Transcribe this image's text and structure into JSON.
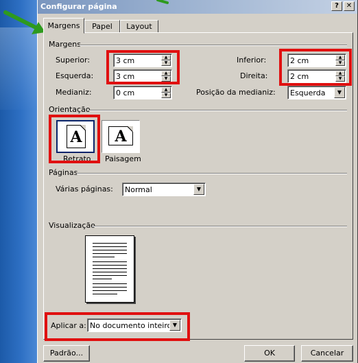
{
  "dialog": {
    "title": "Configurar página",
    "help_label": "?",
    "close_label": "✕"
  },
  "tabs": [
    {
      "label": "Margens"
    },
    {
      "label": "Papel"
    },
    {
      "label": "Layout"
    }
  ],
  "margins": {
    "group_title": "Margens",
    "top": {
      "label": "Superior:",
      "value": "3 cm"
    },
    "left": {
      "label": "Esquerda:",
      "value": "3 cm"
    },
    "gutter": {
      "label": "Medianiz:",
      "value": "0 cm"
    },
    "bottom": {
      "label": "Inferior:",
      "value": "2 cm"
    },
    "right": {
      "label": "Direita:",
      "value": "2 cm"
    },
    "gutter_position": {
      "label": "Posição da medianiz:",
      "value": "Esquerda"
    }
  },
  "orientation": {
    "group_title": "Orientação",
    "portrait": {
      "label": "Retrato",
      "glyph": "A"
    },
    "landscape": {
      "label": "Paisagem",
      "glyph": "A"
    }
  },
  "pages": {
    "group_title": "Páginas",
    "multiple_pages": {
      "label": "Várias páginas:",
      "value": "Normal"
    }
  },
  "preview": {
    "group_title": "Visualização",
    "apply_to": {
      "label": "Aplicar a:",
      "value": "No documento inteiro"
    }
  },
  "buttons": {
    "default_label": "Padrão...",
    "ok_label": "OK",
    "cancel_label": "Cancelar"
  },
  "colors": {
    "highlight": "#e01010",
    "annotation_arrow": "#2e9a1e",
    "titlebar": "#7a96bf",
    "dialog_face": "#d4d0c8"
  }
}
